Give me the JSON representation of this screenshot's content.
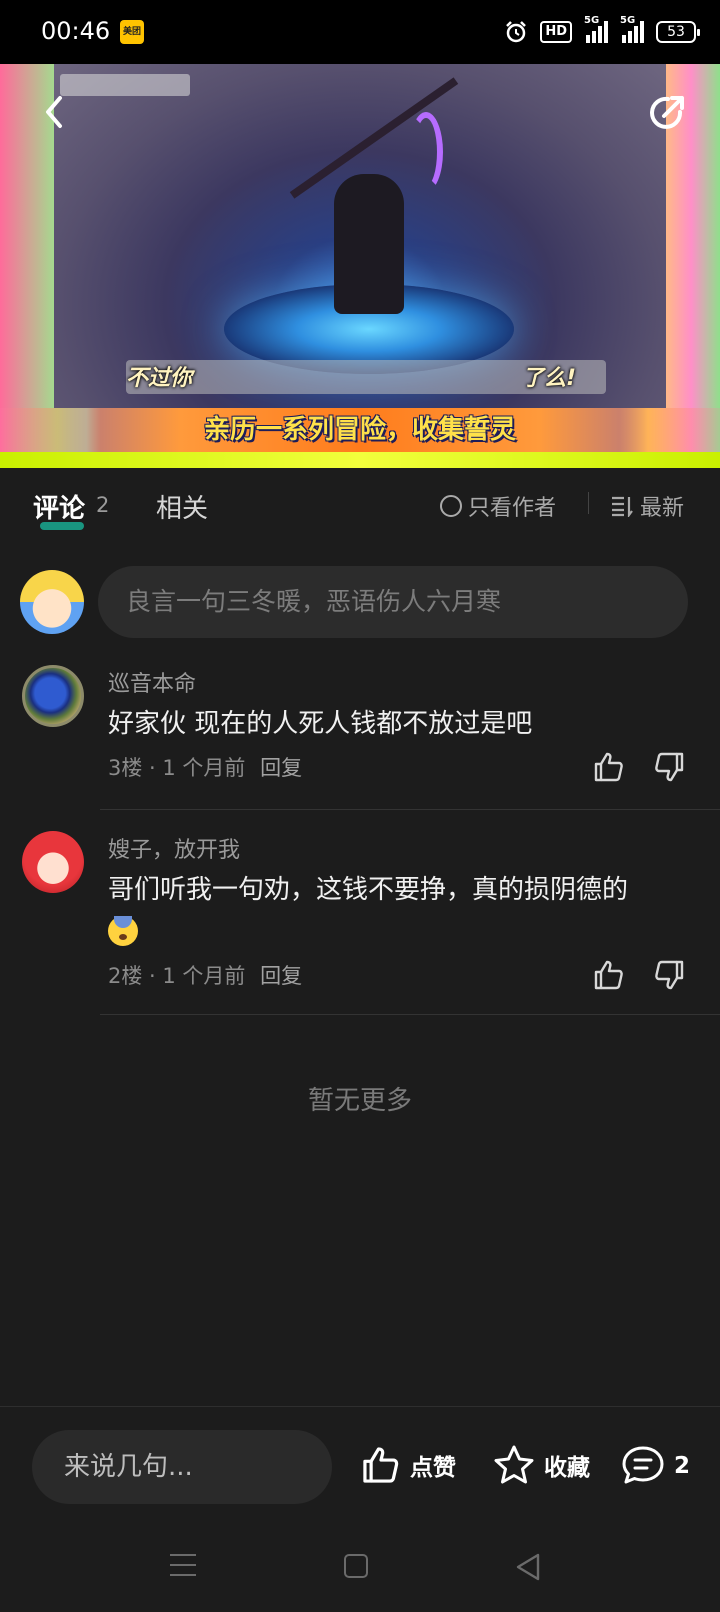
{
  "status_bar": {
    "time": "00:46",
    "app_badge": "美团",
    "hd_label": "HD",
    "signal1_label": "5G",
    "signal2_label": "5G",
    "battery": "53"
  },
  "video": {
    "caption_left": "不过你",
    "caption_right": "了么!",
    "subtitle": "亲历一系列冒险，收集誓灵"
  },
  "tabs": {
    "comments_label": "评论",
    "comments_count": "2",
    "related_label": "相关",
    "author_only_label": "只看作者",
    "sort_label": "最新"
  },
  "comment_input": {
    "placeholder": "良言一句三冬暖，恶语伤人六月寒"
  },
  "comments": [
    {
      "user": "巡音本命",
      "text": "好家伙 现在的人死人钱都不放过是吧",
      "floor_time": "3楼 · 1 个月前",
      "reply_label": "回复"
    },
    {
      "user": "嫂子，放开我",
      "text": "哥们听我一句劝，这钱不要挣，真的损阴德的",
      "floor_time": "2楼 · 1 个月前",
      "reply_label": "回复"
    }
  ],
  "no_more": "暂无更多",
  "bottom_bar": {
    "input_placeholder": "来说几句...",
    "like_label": "点赞",
    "favorite_label": "收藏",
    "comment_count": "2"
  },
  "colors": {
    "background": "#1c1c1c",
    "accent_underline": "#1aa38c",
    "subtitle_text": "#ffe14a"
  },
  "icons": [
    "back-arrow-icon",
    "share-icon",
    "radio-circle-icon",
    "sort-icon",
    "thumbs-up-icon",
    "thumbs-down-icon",
    "star-icon",
    "comment-bubble-icon",
    "menu-icon",
    "home-square-icon",
    "back-triangle-icon"
  ]
}
